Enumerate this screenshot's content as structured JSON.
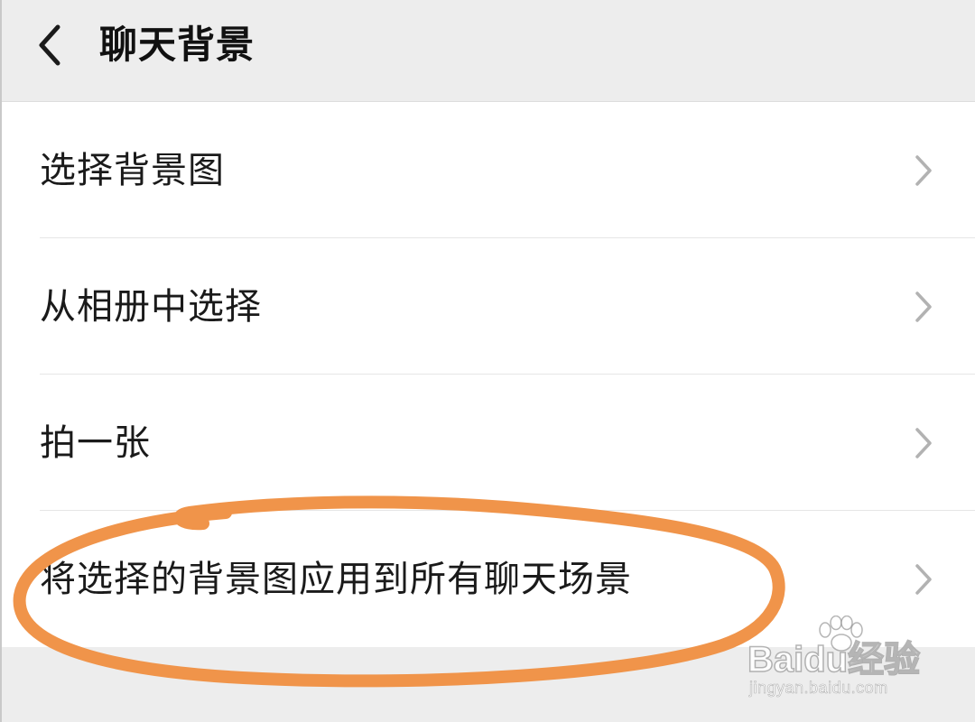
{
  "header": {
    "back_icon": "chevron-left-icon",
    "title": "聊天背景"
  },
  "menu": {
    "items": [
      {
        "label": "选择背景图",
        "icon": "chevron-right-icon"
      },
      {
        "label": "从相册中选择",
        "icon": "chevron-right-icon"
      },
      {
        "label": "拍一张",
        "icon": "chevron-right-icon"
      },
      {
        "label": "将选择的背景图应用到所有聊天场景",
        "icon": "chevron-right-icon",
        "highlighted": true
      }
    ]
  },
  "annotation": {
    "shape": "hand-drawn ellipse",
    "color": "#f0944a"
  },
  "watermark": {
    "brand": "Baidu经验",
    "url": "jingyan.baidu.com"
  },
  "colors": {
    "header_bg": "#ededed",
    "list_bg": "#ffffff",
    "text": "#1a1a1a",
    "chevron": "#b2b2b2",
    "divider": "#e6e6e6"
  }
}
